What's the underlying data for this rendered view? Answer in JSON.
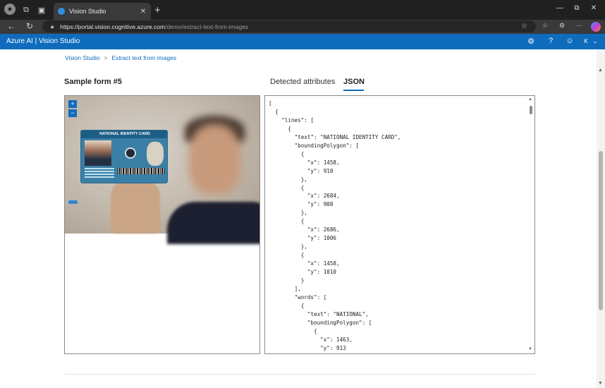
{
  "browser": {
    "tab_title": "Vision Studio",
    "tab_close": "✕",
    "new_tab": "+",
    "url_host": "https://portal.vision.cognitive.azure.com",
    "url_path": "/demo/extract-text-from-images",
    "window_controls": [
      "—",
      "⧉",
      "✕"
    ]
  },
  "app": {
    "brand": "Azure AI | Vision Studio",
    "header_icons": [
      "gear-icon",
      "help-icon",
      "smiley-icon",
      "user-icon"
    ],
    "accent": "#0f6cbd"
  },
  "breadcrumb": {
    "home": "Vision Studio",
    "separator": ">",
    "current": "Extract text from images"
  },
  "sample": {
    "title": "Sample form #5",
    "card_header": "NATIONAL IDENTITY CARD",
    "zoom_in": "+",
    "zoom_out": "−"
  },
  "result_tabs": {
    "detected": "Detected attributes",
    "json": "JSON",
    "active": "JSON"
  },
  "json_text": "[\n  {\n    \"lines\": [\n      {\n        \"text\": \"NATIONAL IDENTITY CARD\",\n        \"boundingPolygon\": [\n          {\n            \"x\": 1458,\n            \"y\": 910\n          },\n          {\n            \"x\": 2684,\n            \"y\": 908\n          },\n          {\n            \"x\": 2686,\n            \"y\": 1006\n          },\n          {\n            \"x\": 1458,\n            \"y\": 1010\n          }\n        ],\n        \"words\": [\n          {\n            \"text\": \"NATIONAL\",\n            \"boundingPolygon\": [\n              {\n                \"x\": 1463,\n                \"y\": 913\n              ,"
}
